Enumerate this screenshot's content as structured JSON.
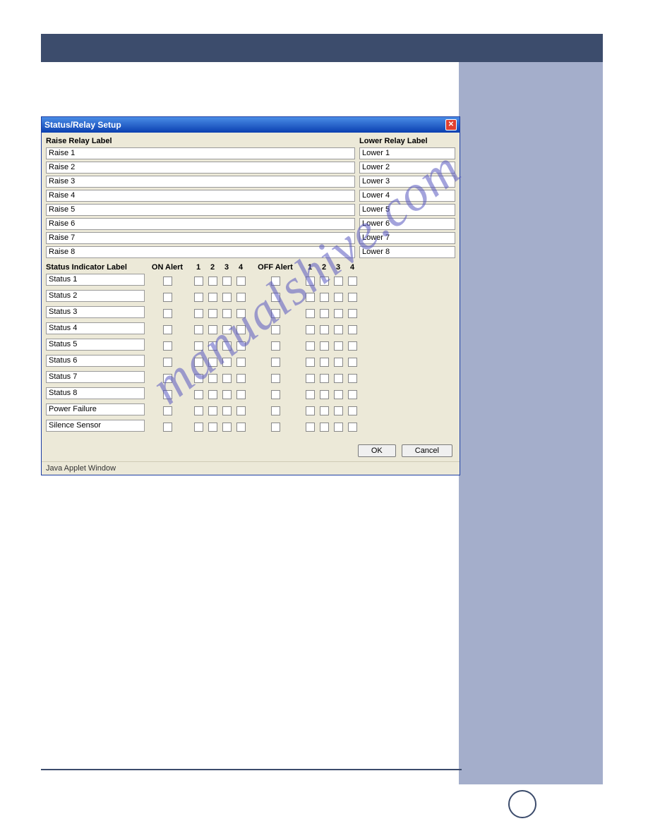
{
  "watermark": "manualshive.com",
  "dialog": {
    "title": "Status/Relay Setup",
    "raise_label": "Raise Relay Label",
    "lower_label": "Lower Relay Label",
    "raise": [
      "Raise 1",
      "Raise 2",
      "Raise 3",
      "Raise 4",
      "Raise 5",
      "Raise 6",
      "Raise 7",
      "Raise 8"
    ],
    "lower": [
      "Lower 1",
      "Lower 2",
      "Lower 3",
      "Lower 4",
      "Lower 5",
      "Lower 6",
      "Lower 7",
      "Lower 8"
    ],
    "status_label": "Status Indicator Label",
    "headers": {
      "on_alert": "ON Alert",
      "off_alert": "OFF Alert",
      "c1": "1",
      "c2": "2",
      "c3": "3",
      "c4": "4"
    },
    "status_rows": [
      "Status 1",
      "Status 2",
      "Status 3",
      "Status 4",
      "Status 5",
      "Status 6",
      "Status 7",
      "Status 8",
      "Power Failure",
      "Silence Sensor"
    ],
    "ok": "OK",
    "cancel": "Cancel",
    "java_line": "Java Applet Window"
  }
}
